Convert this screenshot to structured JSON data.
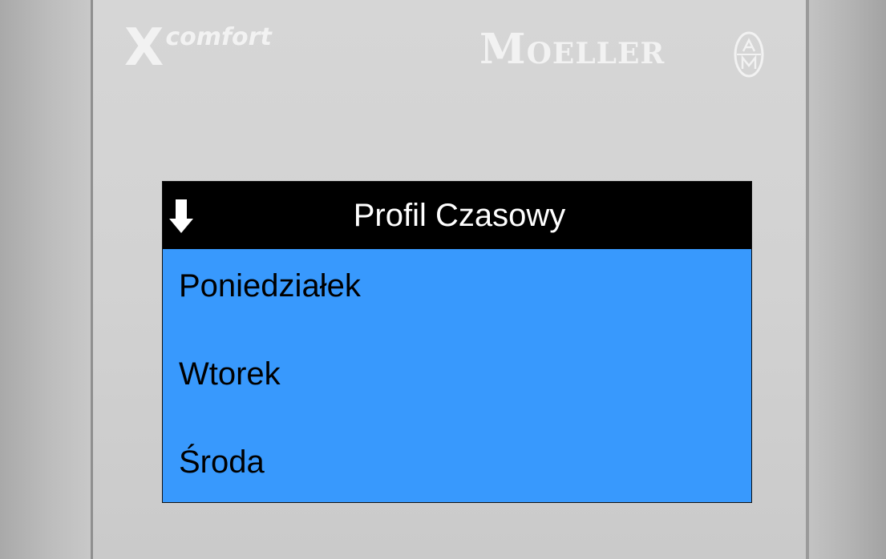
{
  "brand": {
    "product_mark": "X",
    "product_word": "comfort",
    "manufacturer_initial": "M",
    "manufacturer_rest": "OELLER",
    "seal_icon": "moeller-am-seal-icon"
  },
  "screen": {
    "title": "Profil Czasowy",
    "nav_icon": "down-arrow-icon",
    "menu_items": [
      {
        "label": "Poniedziałek"
      },
      {
        "label": "Wtorek"
      },
      {
        "label": "Środa"
      }
    ]
  },
  "colors": {
    "lcd_background": "#3899fd",
    "header_background": "#000000",
    "header_text": "#ffffff",
    "item_text": "#000000",
    "faceplate": "#d2d2d2"
  }
}
